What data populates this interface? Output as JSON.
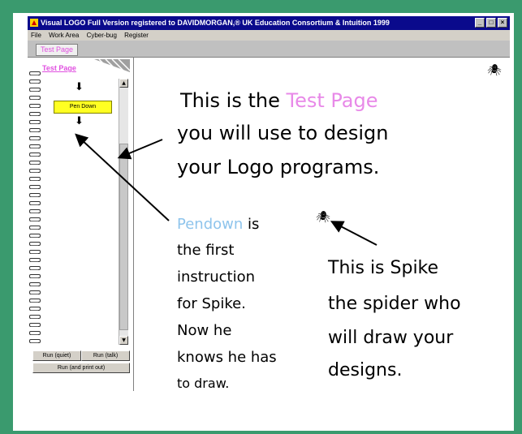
{
  "window": {
    "title": "Visual LOGO Full Version registered to DAVIDMORGAN,® UK Education Consortium & Intuition 1999",
    "controls": [
      "_",
      "□",
      "×"
    ]
  },
  "menu": [
    "File",
    "Work Area",
    "Cyber-bug",
    "Register"
  ],
  "tab": {
    "label": "Test Page"
  },
  "left_panel": {
    "page_link": "Test Page",
    "block_label": "Pen Down",
    "run_quiet": "Run (quiet)",
    "run_talk": "Run (talk)",
    "run_print": "Run (and print out)"
  },
  "annotations": {
    "intro_line1_a": "This is the ",
    "intro_line1_b": "Test Page",
    "intro_line2": "you will use to design",
    "intro_line3": "your Logo programs.",
    "pendown_word": "Pendown",
    "pendown_l1_rest": " is",
    "pendown_l2": "the first",
    "pendown_l3": "instruction",
    "pendown_l4": "for Spike.",
    "pendown_l5": "Now he",
    "pendown_l6": "knows he has",
    "pendown_l7": "to draw.",
    "spike_l1": "This is Spike",
    "spike_l2": "the spider who",
    "spike_l3": "will draw your",
    "spike_l4": "designs."
  },
  "colors": {
    "frame": "#3a9a6e",
    "title_bar": "#0a0a8c",
    "highlight_pink": "#e889e8",
    "highlight_blue": "#8ec4ec",
    "block_yellow": "#ffff22"
  },
  "icons": [
    "logo-icon",
    "spider-icon",
    "down-arrow-icon"
  ]
}
